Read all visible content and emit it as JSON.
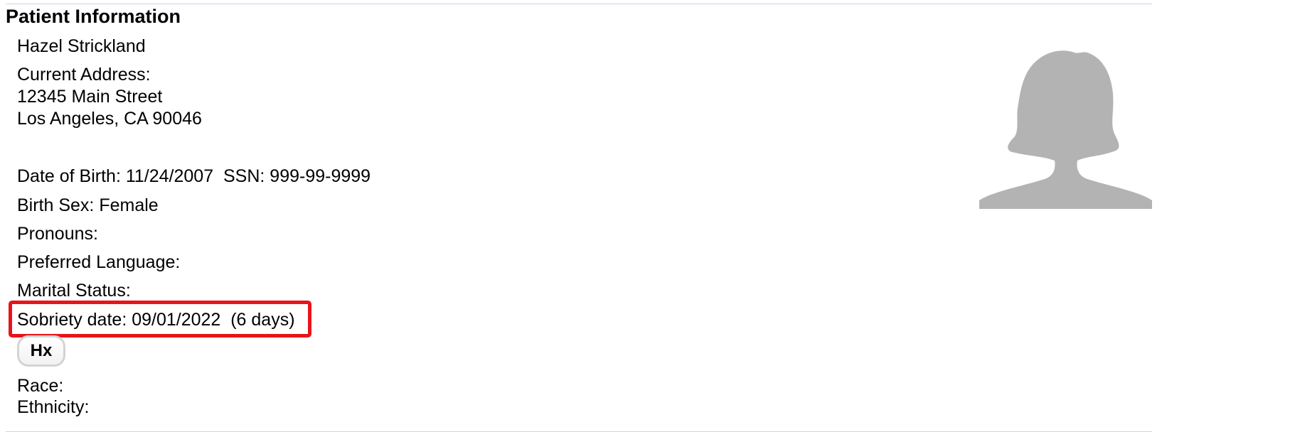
{
  "section": {
    "title": "Patient Information"
  },
  "patient": {
    "name": "Hazel Strickland",
    "address_label": "Current Address:",
    "address_line1": "12345 Main Street",
    "address_line2": "Los Angeles, CA 90046",
    "dob_ssn": "Date of Birth: 11/24/2007  SSN: 999-99-9999",
    "birth_sex": "Birth Sex: Female",
    "pronouns": "Pronouns:",
    "preferred_language": "Preferred Language:",
    "marital_status": "Marital Status:",
    "sobriety_date": "Sobriety date: 09/01/2022  (6 days)",
    "race": "Race:",
    "ethnicity": "Ethnicity:"
  },
  "buttons": {
    "hx_label": "Hx"
  },
  "colors": {
    "highlight_border": "#e8141b",
    "avatar_fill": "#b3b3b3",
    "divider": "#c9d6e8"
  },
  "icons": {
    "avatar": "female-silhouette-avatar"
  }
}
